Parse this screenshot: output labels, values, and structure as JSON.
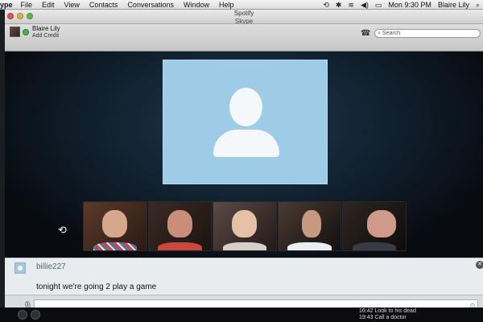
{
  "menubar": {
    "app_name": "ype",
    "items": [
      "File",
      "Edit",
      "View",
      "Contacts",
      "Conversations",
      "Window",
      "Help"
    ],
    "clock": "Mon 9:30 PM",
    "user": "Blaire Lily"
  },
  "window": {
    "title": "Spotify",
    "subtitle": "Skype"
  },
  "account": {
    "name": "Blaire Lily",
    "credit_link": "Add Credit"
  },
  "search": {
    "placeholder": "Search"
  },
  "call": {
    "participants_icon": "rotate-icon"
  },
  "chat": {
    "sender": "billie227",
    "message": "tonight we're going 2 play a game"
  },
  "background": {
    "line1": "16:42 Look to his dead",
    "line2": "19:43 Call a doctor"
  },
  "colors": {
    "accent": "#4cb34a",
    "self_video_bg": "#9ecbe6"
  }
}
